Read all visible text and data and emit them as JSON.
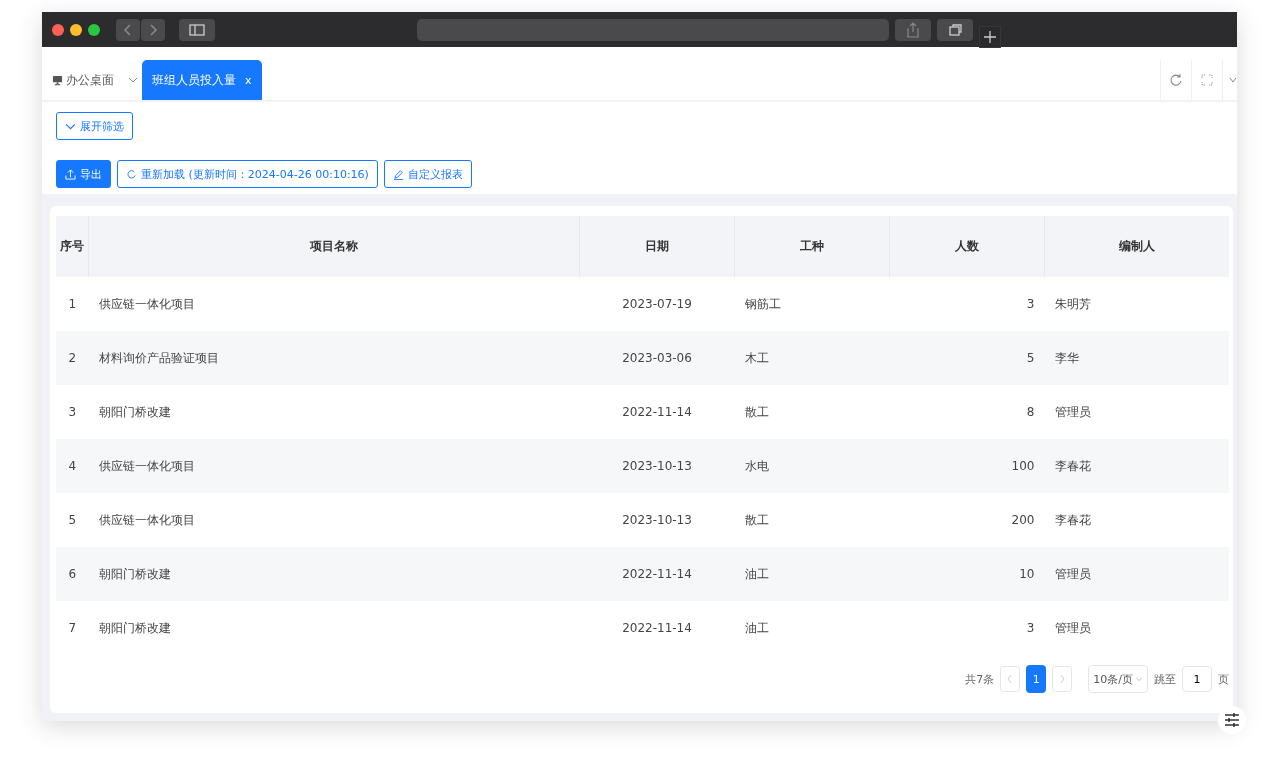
{
  "tabs": [
    {
      "label": "办公桌面",
      "selected": false,
      "kind": "home"
    },
    {
      "label": "班组人员投入量",
      "selected": true,
      "kind": "page",
      "close": "x"
    }
  ],
  "filter_button": "展开筛选",
  "toolbar": [
    {
      "label": "导出",
      "kind": "export"
    },
    {
      "label": "重新加载 (更新时间：2024-04-26 00:10:16)",
      "kind": "reload"
    },
    {
      "label": "自定义报表",
      "kind": "edit"
    }
  ],
  "table": {
    "columns": [
      "序号",
      "项目名称",
      "日期",
      "工种",
      "人数",
      "编制人"
    ],
    "rows": [
      [
        "1",
        "供应链一体化项目",
        "2023-07-19",
        "钢筋工",
        "3",
        "朱明芳"
      ],
      [
        "2",
        "材料询价产品验证项目",
        "2023-03-06",
        "木工",
        "5",
        "李华"
      ],
      [
        "3",
        "朝阳门桥改建",
        "2022-11-14",
        "散工",
        "8",
        "管理员"
      ],
      [
        "4",
        "供应链一体化项目",
        "2023-10-13",
        "水电",
        "100",
        "李春花"
      ],
      [
        "5",
        "供应链一体化项目",
        "2023-10-13",
        "散工",
        "200",
        "李春花"
      ],
      [
        "6",
        "朝阳门桥改建",
        "2022-11-14",
        "油工",
        "10",
        "管理员"
      ],
      [
        "7",
        "朝阳门桥改建",
        "2022-11-14",
        "油工",
        "3",
        "管理员"
      ]
    ]
  },
  "pagination": {
    "total": "共7条",
    "pages": [
      {
        "label": "1",
        "selected": true
      }
    ],
    "page_size": "10条/页",
    "goto_label": "跳至",
    "goto_value": "1",
    "goto_suffix": "页"
  }
}
